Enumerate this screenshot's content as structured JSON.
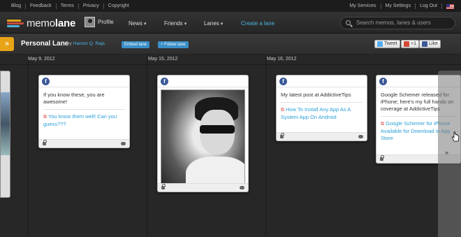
{
  "topbar": {
    "left_links": [
      "Blog",
      "Feedback",
      "Terms",
      "Privacy",
      "Copyright"
    ],
    "right_links": [
      "My Services",
      "My Settings",
      "Log Out"
    ]
  },
  "nav": {
    "logo_prefix": "memo",
    "logo_suffix": "lane",
    "profile": "Profile",
    "news": "News",
    "friends": "Friends",
    "lanes": "Lanes",
    "create": "Create a lane",
    "search_placeholder": "Search memos, lanes & users"
  },
  "lane": {
    "expand_icon": "»",
    "title": "Personal Lane",
    "by": "by",
    "author": "Haroon Q. Raja",
    "embed": "Embed lane",
    "follow": "+ Follow lane",
    "tweet": "Tweet",
    "gplus": "+1",
    "like": "Like"
  },
  "timeline": {
    "dates": [
      "May 9, 2012",
      "May 15, 2012",
      "May 16, 2012"
    ],
    "cards": [
      {
        "text": "If you know these, you are awesome!",
        "link": "You know them well! Can you guess???"
      },
      {
        "text": "My latest post at AddictiveTips",
        "link": "How To Install Any App As A System App On Android"
      },
      {
        "text": "Google Schemer released for iPhone; here's my full hands on coverage at AddictiveTips",
        "link": "Google Schemer for iPhone Available for Download in App Store"
      }
    ],
    "next_arrows": "»"
  },
  "colors": {
    "accent": "#4cb3e0",
    "expand": "#e8a417",
    "facebook": "#3b5998",
    "pill": "#3a8fc7"
  }
}
